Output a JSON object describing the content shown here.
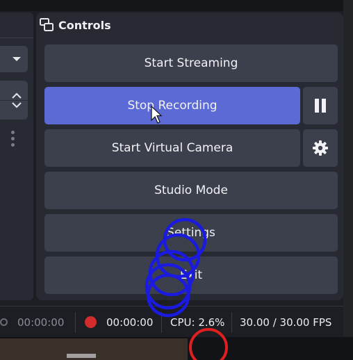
{
  "dock": {
    "title": "Controls",
    "icon": "dock-controls-icon"
  },
  "controls": {
    "start_streaming": "Start Streaming",
    "stop_recording": "Stop Recording",
    "start_virtual_camera": "Start Virtual Camera",
    "studio_mode": "Studio Mode",
    "settings": "Settings",
    "exit": "Exit"
  },
  "status": {
    "stream_time": "00:00:00",
    "rec_time": "00:00:00",
    "cpu": "CPU: 2.6%",
    "fps": "30.00 / 30.00 FPS"
  },
  "colors": {
    "accent": "#5c6ad6",
    "recording": "#d22c2c",
    "annotation_blue": "#1a1ae0",
    "annotation_red": "#e02020"
  }
}
